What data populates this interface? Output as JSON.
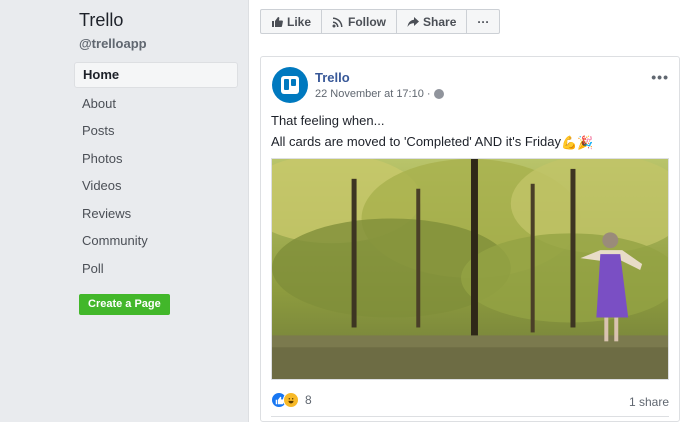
{
  "sidebar": {
    "page_name": "Trello",
    "handle": "@trelloapp",
    "items": [
      {
        "label": "Home",
        "active": true
      },
      {
        "label": "About"
      },
      {
        "label": "Posts"
      },
      {
        "label": "Photos"
      },
      {
        "label": "Videos"
      },
      {
        "label": "Reviews"
      },
      {
        "label": "Community"
      },
      {
        "label": "Poll"
      }
    ],
    "create_label": "Create a Page"
  },
  "actions": {
    "like": "Like",
    "follow": "Follow",
    "share": "Share",
    "more": "···"
  },
  "post": {
    "author": "Trello",
    "timestamp": "22 November at 17:10 ·",
    "line1": "That feeling when...",
    "line2": "All cards are moved to 'Completed' AND it's Friday",
    "line2_emoji": "💪🎉",
    "reaction_count": "8",
    "shares": "1 share",
    "more": "•••"
  },
  "colors": {
    "brand": "#0079bf",
    "link": "#385898",
    "create_button": "#42b72a",
    "like_reaction": "#1877f2",
    "haha_reaction": "#f7b928"
  },
  "icons": {
    "like": "thumbs-up-icon",
    "follow": "rss-icon",
    "share": "share-arrow-icon",
    "privacy": "globe-icon",
    "avatar": "trello-logo-icon"
  }
}
